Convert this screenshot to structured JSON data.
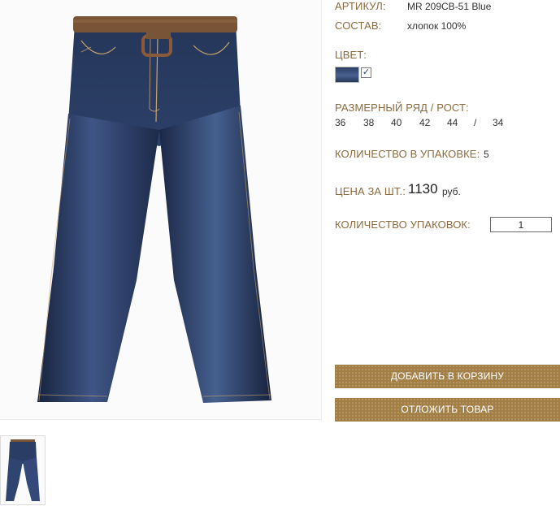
{
  "product": {
    "article_label": "АРТИКУЛ:",
    "article_value": "MR 209CB-51 Blue",
    "composition_label": "СОСТАВ:",
    "composition_value": "хлопок 100%",
    "color_label": "ЦВЕТ:",
    "color_swatch": "#2f4470",
    "color_checked_mark": "✓",
    "size_label": "РАЗМЕРНЫЙ РЯД / РОСТ:",
    "sizes": [
      "36",
      "38",
      "40",
      "42",
      "44",
      "/",
      "34"
    ],
    "pack_label": "КОЛИЧЕСТВО В УПАКОВКЕ:",
    "pack_value": "5",
    "price_label": "ЦЕНА ЗА ШТ.:",
    "price_value": "1130",
    "price_currency": "руб.",
    "packs_label": "КОЛИЧЕСТВО УПАКОВОК:",
    "packs_value": "1"
  },
  "buttons": {
    "add_to_cart": "ДОБАВИТЬ В КОРЗИНУ",
    "postpone": "ОТЛОЖИТЬ ТОВАР"
  },
  "colors": {
    "label_color": "#8a6a3e",
    "button_color": "#a37e45",
    "denim_dark": "#1c2a4a",
    "denim_light": "#4d6597",
    "belt": "#7a5436"
  }
}
